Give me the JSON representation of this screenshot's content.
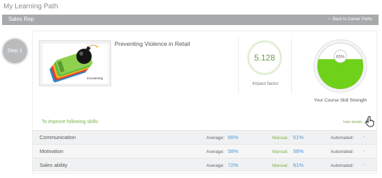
{
  "page": {
    "title": "My Learning Path"
  },
  "role_bar": {
    "role": "Sales Rep",
    "back_link": "Back to Career Paths"
  },
  "step": {
    "label": "Step 1"
  },
  "course": {
    "title": "Preventing Violence in Retail",
    "thumbnail_caption": "4ALearning",
    "impact_factor": "5.128",
    "impact_label": "Impact factor",
    "skill_strength_percent": "65%",
    "skill_strength_fill": 0.65,
    "skill_strength_label": "Your Course Skill Strength"
  },
  "skills_section": {
    "heading": "To improve following skills:",
    "toggle_label": "hide details",
    "average_label": "Average:",
    "manual_label": "Manual:",
    "automated_label": "Automated:",
    "rows": [
      {
        "name": "Communication",
        "average": "66%",
        "manual": "51%",
        "automated": "-"
      },
      {
        "name": "Motivation",
        "average": "58%",
        "manual": "58%",
        "automated": "-"
      },
      {
        "name": "Sales ability",
        "average": "72%",
        "manual": "61%",
        "automated": "-"
      }
    ]
  },
  "colors": {
    "accent_green": "#7cb342",
    "value_blue": "#4a9ad4",
    "gauge_fill": "#6fd11a",
    "bar_gray": "#a7a9ab"
  },
  "icons": [
    "chevron-left-icon",
    "hand-pointer-icon",
    "course-thumbnail-icon"
  ]
}
